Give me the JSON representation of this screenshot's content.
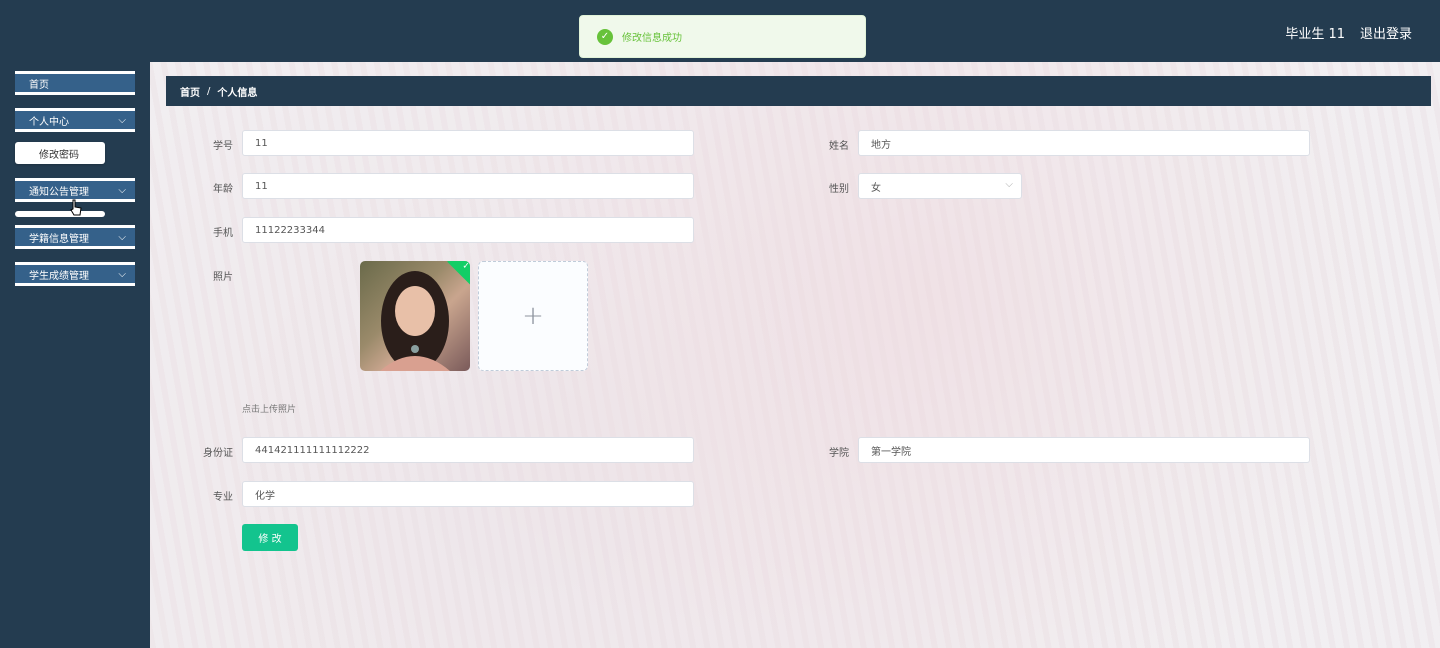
{
  "header": {
    "user": "毕业生 11",
    "logout": "退出登录"
  },
  "toast": {
    "message": "修改信息成功"
  },
  "sidebar": {
    "home": "首页",
    "personal_center": "个人中心",
    "change_password": "修改密码",
    "notice_management": "通知公告管理",
    "status_management": "学籍信息管理",
    "grade_management": "学生成绩管理"
  },
  "breadcrumb": {
    "home": "首页",
    "separator": "/",
    "current": "个人信息"
  },
  "form": {
    "student_id": {
      "label": "学号",
      "value": "11"
    },
    "name": {
      "label": "姓名",
      "value": "地方"
    },
    "age": {
      "label": "年龄",
      "value": "11"
    },
    "gender": {
      "label": "性别",
      "value": "女"
    },
    "phone": {
      "label": "手机",
      "value": "11122233344"
    },
    "photo": {
      "label": "照片",
      "tip": "点击上传照片"
    },
    "id_card": {
      "label": "身份证",
      "value": "441421111111112222"
    },
    "college": {
      "label": "学院",
      "value": "第一学院"
    },
    "major": {
      "label": "专业",
      "value": "化学"
    },
    "submit": "修 改"
  },
  "colors": {
    "header": "#243c50",
    "menu": "#35618a",
    "button": "#13c48e",
    "success": "#67c23a"
  }
}
